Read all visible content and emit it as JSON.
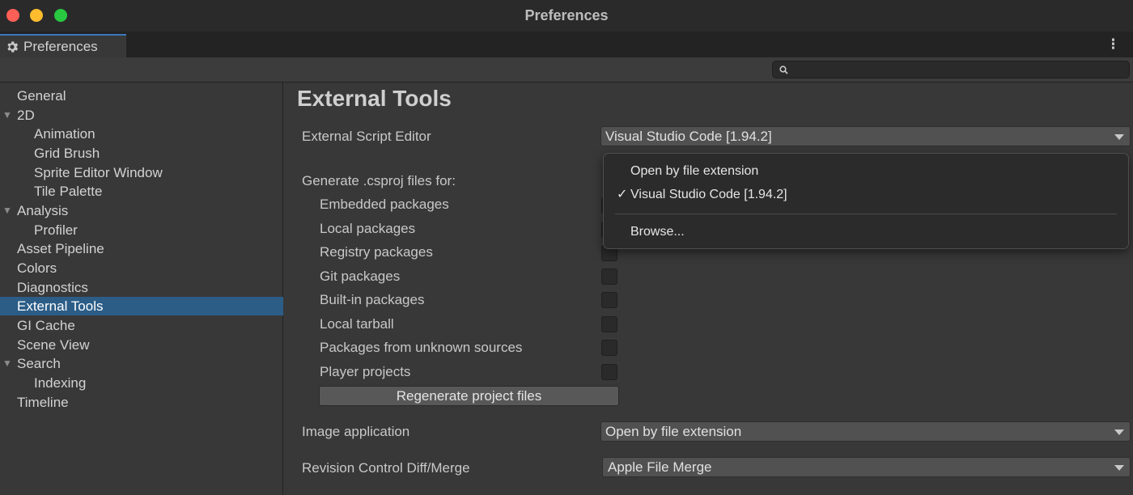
{
  "window": {
    "title": "Preferences"
  },
  "tab": {
    "label": "Preferences",
    "icon": "gear-icon"
  },
  "search": {
    "value": "",
    "placeholder": ""
  },
  "sidebar": {
    "items": [
      {
        "label": "General",
        "indent": 0,
        "expandable": false,
        "selected": false
      },
      {
        "label": "2D",
        "indent": 0,
        "expandable": true,
        "selected": false
      },
      {
        "label": "Animation",
        "indent": 1,
        "expandable": false,
        "selected": false
      },
      {
        "label": "Grid Brush",
        "indent": 1,
        "expandable": false,
        "selected": false
      },
      {
        "label": "Sprite Editor Window",
        "indent": 1,
        "expandable": false,
        "selected": false
      },
      {
        "label": "Tile Palette",
        "indent": 1,
        "expandable": false,
        "selected": false
      },
      {
        "label": "Analysis",
        "indent": 0,
        "expandable": true,
        "selected": false
      },
      {
        "label": "Profiler",
        "indent": 1,
        "expandable": false,
        "selected": false
      },
      {
        "label": "Asset Pipeline",
        "indent": 0,
        "expandable": false,
        "selected": false
      },
      {
        "label": "Colors",
        "indent": 0,
        "expandable": false,
        "selected": false
      },
      {
        "label": "Diagnostics",
        "indent": 0,
        "expandable": false,
        "selected": false
      },
      {
        "label": "External Tools",
        "indent": 0,
        "expandable": false,
        "selected": true
      },
      {
        "label": "GI Cache",
        "indent": 0,
        "expandable": false,
        "selected": false
      },
      {
        "label": "Scene View",
        "indent": 0,
        "expandable": false,
        "selected": false
      },
      {
        "label": "Search",
        "indent": 0,
        "expandable": true,
        "selected": false
      },
      {
        "label": "Indexing",
        "indent": 1,
        "expandable": false,
        "selected": false
      },
      {
        "label": "Timeline",
        "indent": 0,
        "expandable": false,
        "selected": false
      }
    ]
  },
  "main": {
    "title": "External Tools",
    "external_script_editor": {
      "label": "External Script Editor",
      "value": "Visual Studio Code [1.94.2]"
    },
    "generate_label": "Generate .csproj files for:",
    "packages": [
      {
        "label": "Embedded packages",
        "checked": false
      },
      {
        "label": "Local packages",
        "checked": false
      },
      {
        "label": "Registry packages",
        "checked": false
      },
      {
        "label": "Git packages",
        "checked": false
      },
      {
        "label": "Built-in packages",
        "checked": false
      },
      {
        "label": "Local tarball",
        "checked": false
      },
      {
        "label": "Packages from unknown sources",
        "checked": false
      },
      {
        "label": "Player projects",
        "checked": false
      }
    ],
    "regenerate_button": "Regenerate project files",
    "image_application": {
      "label": "Image application",
      "value": "Open by file extension"
    },
    "revision_control": {
      "label": "Revision Control Diff/Merge",
      "value": "Apple File Merge"
    }
  },
  "popup": {
    "items": [
      {
        "label": "Open by file extension",
        "checked": false
      },
      {
        "label": "Visual Studio Code [1.94.2]",
        "checked": true
      },
      {
        "label": "Browse...",
        "checked": false
      }
    ],
    "check_mark": "✓"
  },
  "colors": {
    "selection": "#2c5d87",
    "tab_accent": "#3a79bb",
    "close": "#fe5f57",
    "minimize": "#febc2e",
    "maximize": "#28c840"
  }
}
